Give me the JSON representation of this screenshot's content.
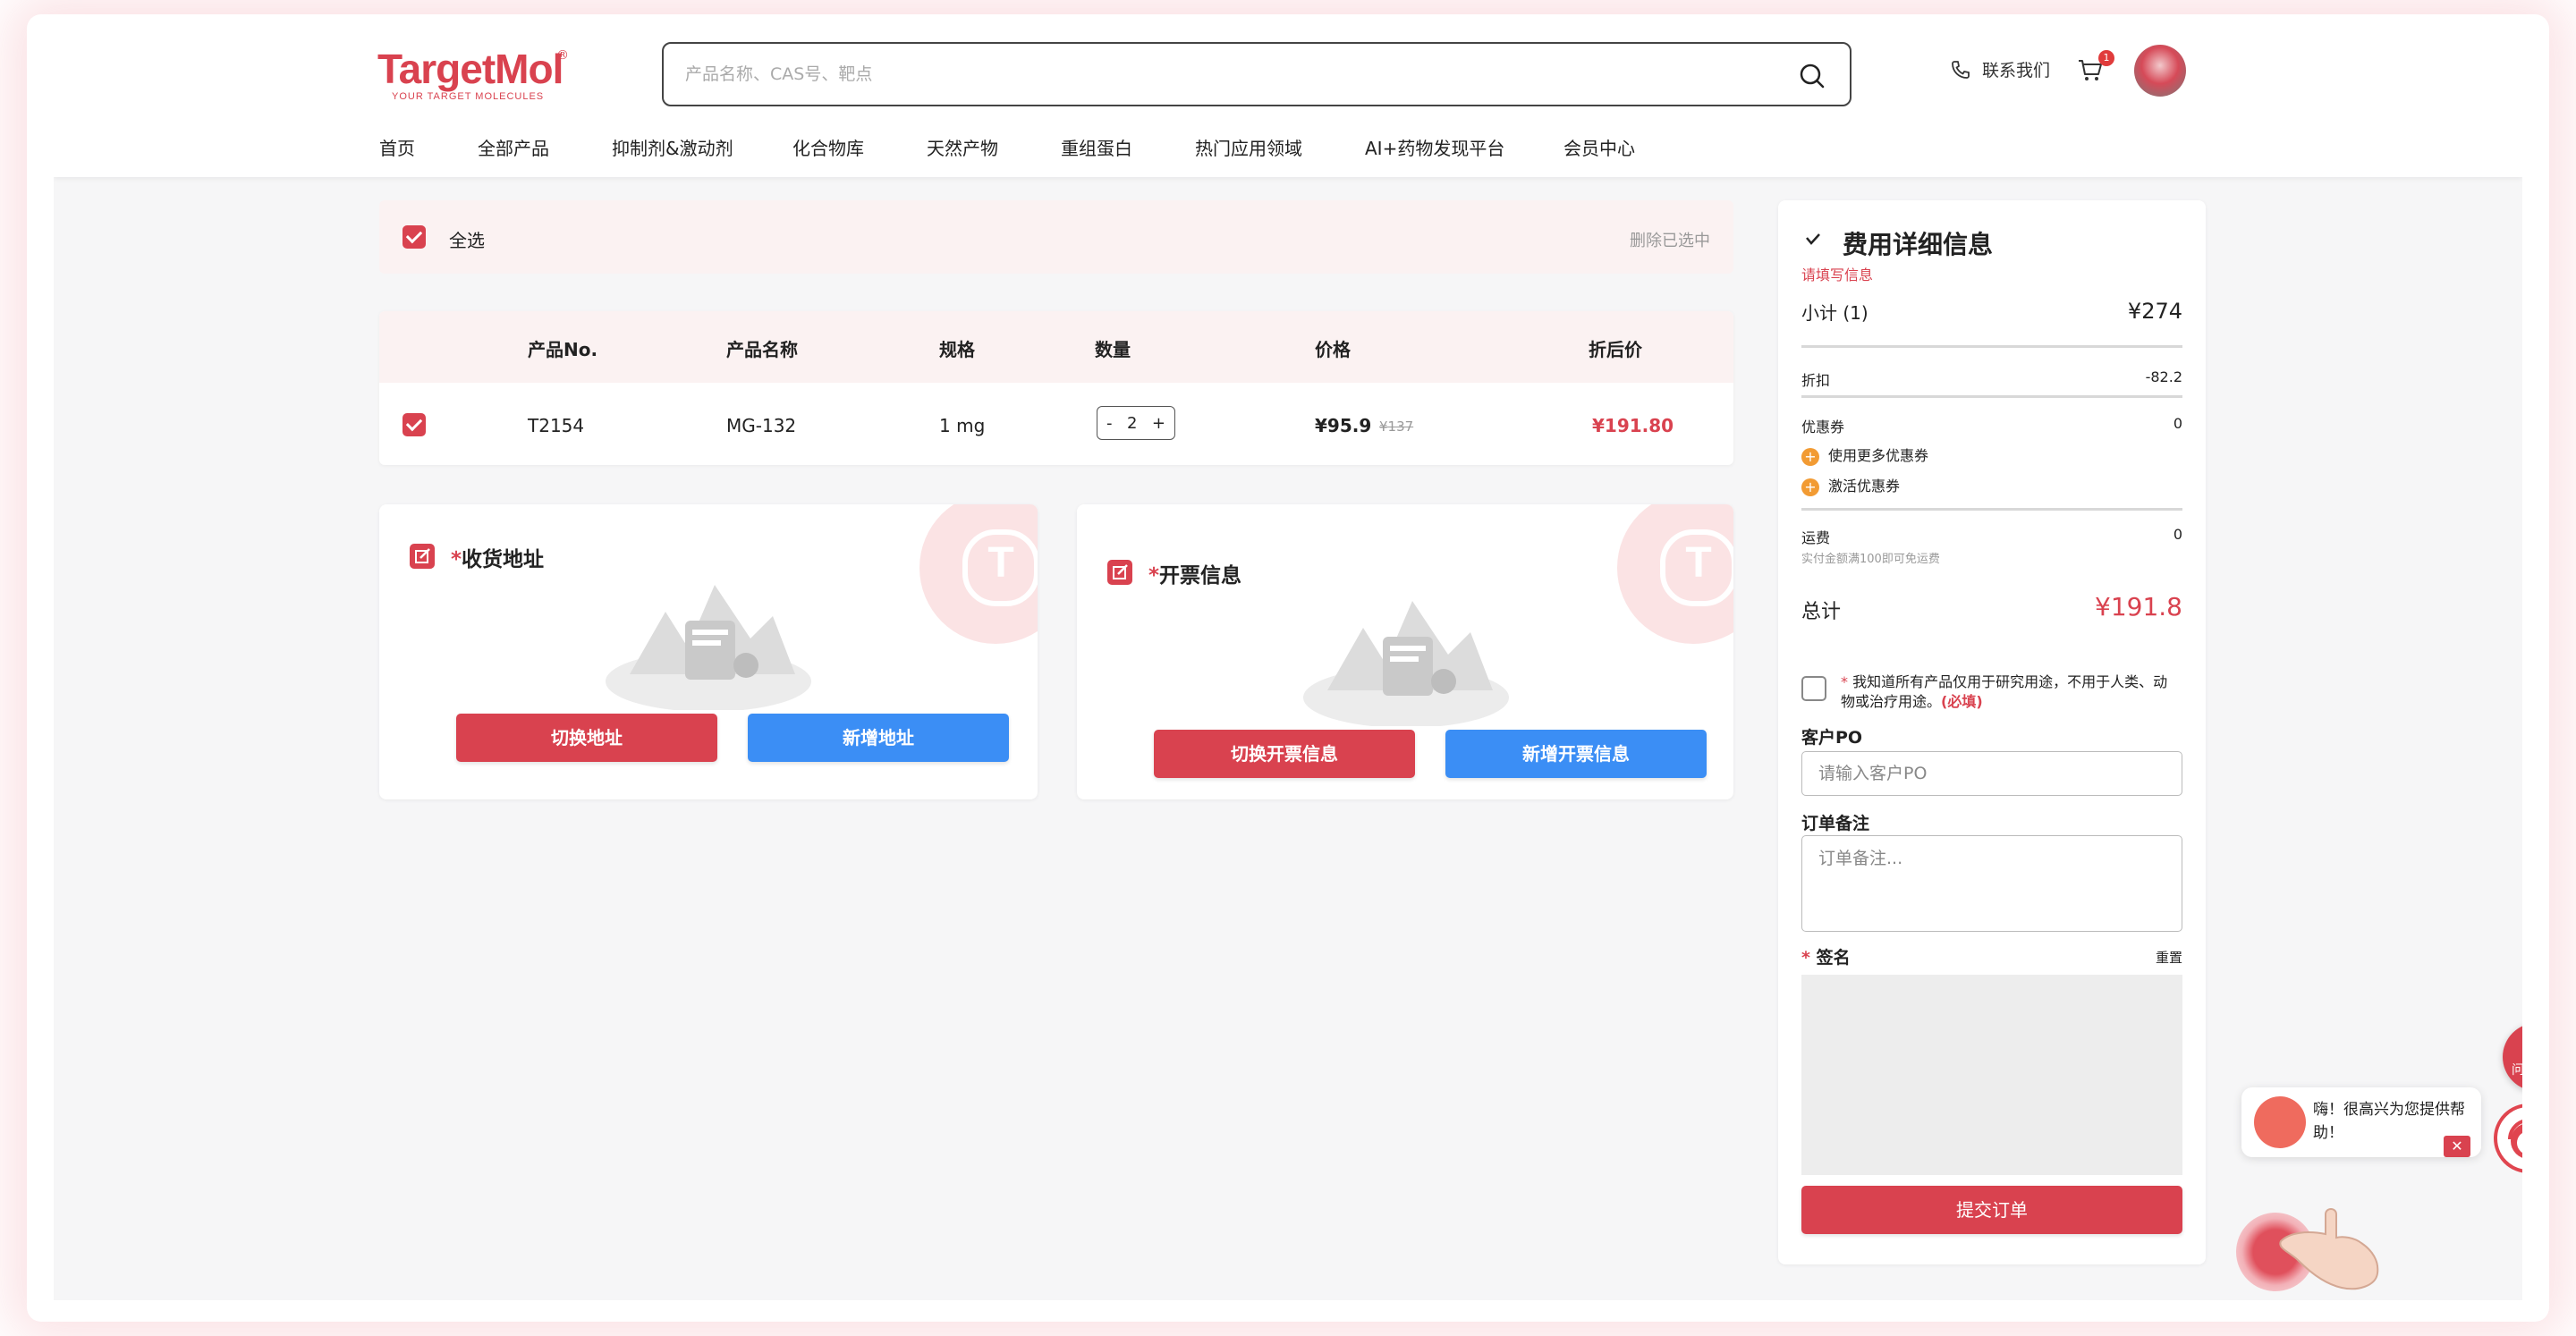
{
  "header": {
    "logo_text": "TargetMol",
    "logo_tagline": "YOUR TARGET MOLECULES",
    "search_placeholder": "产品名称、CAS号、靶点",
    "contact_label": "联系我们",
    "cart_count": "1"
  },
  "nav": [
    "首页",
    "全部产品",
    "抑制剂&激动剂",
    "化合物库",
    "天然产物",
    "重组蛋白",
    "热门应用领域",
    "AI+药物发现平台",
    "会员中心"
  ],
  "select_bar": {
    "select_all_label": "全选",
    "delete_selected_label": "删除已选中"
  },
  "table": {
    "headers": [
      "产品No.",
      "产品名称",
      "规格",
      "数量",
      "价格",
      "折后价"
    ],
    "rows": [
      {
        "product_no": "T2154",
        "product_name": "MG-132",
        "size": "1 mg",
        "quantity": "2",
        "price": "¥95.9",
        "original_price": "¥137",
        "discounted_price": "¥191.80"
      }
    ]
  },
  "shipping": {
    "title_star": "*",
    "title": "收货地址",
    "switch_button": "切换地址",
    "add_button": "新增地址"
  },
  "invoice": {
    "title_star": "*",
    "title": "开票信息",
    "switch_button": "切换开票信息",
    "add_button": "新增开票信息"
  },
  "summary": {
    "title": "费用详细信息",
    "notice": "请填写信息",
    "subtotal_label": "小计 (1)",
    "subtotal_value": "¥274",
    "discount_label": "折扣",
    "discount_value": "-82.2",
    "coupon_label": "优惠券",
    "coupon_value": "0",
    "use_more_coupons": "使用更多优惠券",
    "activate_coupon": "激活优惠券",
    "shipping_label": "运费",
    "shipping_value": "0",
    "shipping_note": "实付金额满100即可免运费",
    "total_label": "总计",
    "total_value": "¥191.8",
    "agreement_star": "*",
    "agreement_text": "我知道所有产品仅用于研究用途，不用于人类、动物或治疗用途。",
    "agreement_required": "(必填)",
    "po_label": "客户PO",
    "po_placeholder": "请输入客户PO",
    "remark_label": "订单备注",
    "remark_placeholder": "订单备注...",
    "signature_star": "*",
    "signature_label": "签名",
    "reset_label": "重置",
    "submit_button": "提交订单"
  },
  "widgets": {
    "survey_label": "问卷调研",
    "chat_text": "嗨！很高兴为您提供帮助！",
    "chat_close": "✕"
  },
  "colors": {
    "brand_red": "#d9424f",
    "action_blue": "#3b8ef5",
    "coupon_orange": "#f29b33"
  }
}
